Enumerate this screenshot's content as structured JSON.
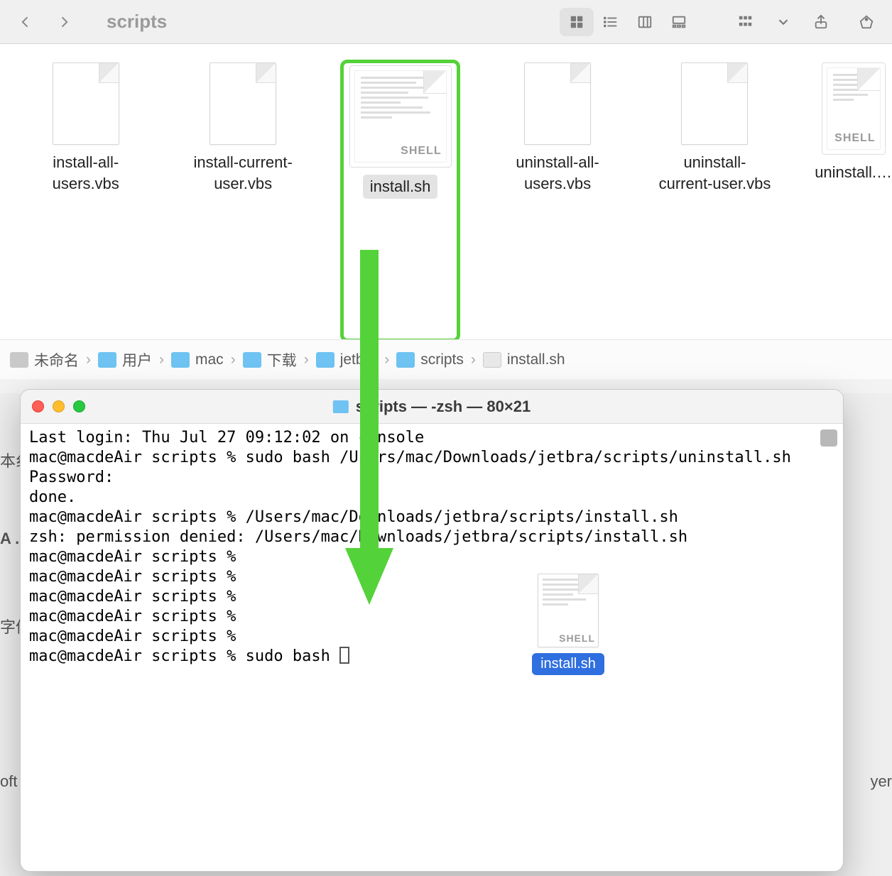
{
  "finder": {
    "title": "scripts",
    "files": [
      {
        "name": "install-all-users.vbs",
        "type": "vbs"
      },
      {
        "name": "install-current-user.vbs",
        "type": "vbs"
      },
      {
        "name": "install.sh",
        "type": "sh",
        "selected": true
      },
      {
        "name": "uninstall-all-users.vbs",
        "type": "vbs"
      },
      {
        "name": "uninstall-current-user.vbs",
        "type": "vbs"
      },
      {
        "name": "uninstall.…",
        "type": "sh"
      }
    ],
    "shell_badge": "SHELL",
    "path": [
      {
        "icon": "disk",
        "label": "未命名"
      },
      {
        "icon": "folder",
        "label": "用户"
      },
      {
        "icon": "folder",
        "label": "mac"
      },
      {
        "icon": "folder",
        "label": "下载"
      },
      {
        "icon": "folder",
        "label": "jetbra"
      },
      {
        "icon": "folder",
        "label": "scripts"
      },
      {
        "icon": "file",
        "label": "install.sh"
      }
    ]
  },
  "terminal": {
    "title": "scripts — -zsh — 80×21",
    "lines": [
      "Last login: Thu Jul 27 09:12:02 on console",
      "mac@macdeAir scripts % sudo bash /Users/mac/Downloads/jetbra/scripts/uninstall.sh",
      "Password:",
      "done.",
      "mac@macdeAir scripts % /Users/mac/Downloads/jetbra/scripts/install.sh",
      "zsh: permission denied: /Users/mac/Downloads/jetbra/scripts/install.sh",
      "mac@macdeAir scripts %",
      "mac@macdeAir scripts %",
      "mac@macdeAir scripts %",
      "mac@macdeAir scripts %",
      "mac@macdeAir scripts %",
      "mac@macdeAir scripts % sudo bash "
    ],
    "drag_file_label": "install.sh"
  },
  "peek": {
    "l1": "本纟",
    "l2": "A .",
    "l3": "字体",
    "l4": "oft",
    "r1": "yer"
  }
}
